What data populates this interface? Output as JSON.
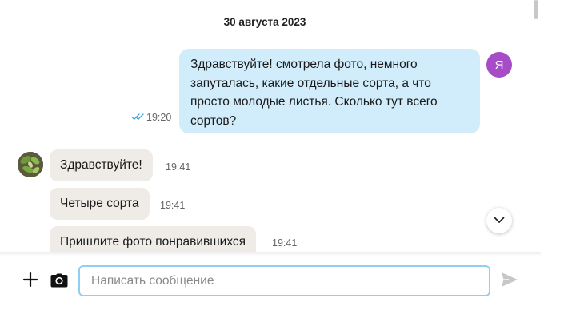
{
  "conversation": {
    "date_separator": "30 августа 2023"
  },
  "outgoing_message": {
    "avatar_letter": "Я",
    "avatar_color": "#a64cc7",
    "lines": [
      "Здравствуйте! смотрела фото, немного",
      "запуталась, какие отдельные сорта, а что",
      "просто молодые листья. Сколько тут всего",
      "сортов?"
    ],
    "time": "19:20",
    "status_icon": "double-check-icon",
    "bubble_color": "#d1ecfb"
  },
  "incoming_messages": [
    {
      "text": "Здравствуйте!",
      "time": "19:41"
    },
    {
      "text": "Четыре сорта",
      "time": "19:41"
    },
    {
      "text": "Пришлите фото понравившихся",
      "time": "19:41"
    }
  ],
  "incoming_bubble_color": "#efece7",
  "composer": {
    "placeholder": "Написать сообщение",
    "value": "",
    "attach_icon": "plus-icon",
    "camera_icon": "camera-icon",
    "send_icon": "send-icon",
    "input_border_color": "#8fd0f1"
  },
  "scroll_down_icon": "chevron-down-icon"
}
